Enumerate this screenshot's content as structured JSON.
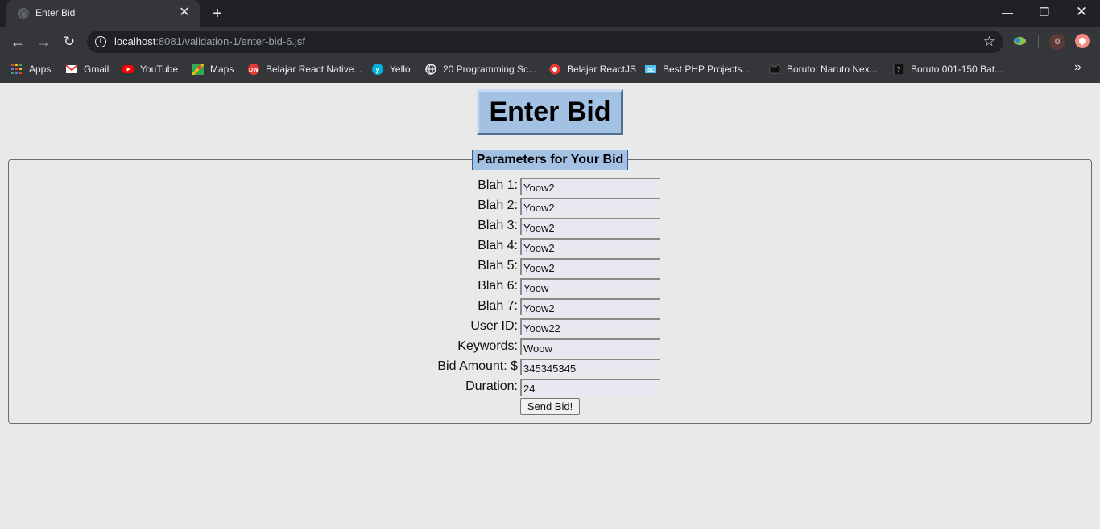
{
  "browser": {
    "tab_title": "Enter Bid",
    "url_host": "localhost",
    "url_path": ":8081/validation-1/enter-bid-6.jsf",
    "extension_badge_count": "0",
    "bookmarks": [
      {
        "label": "Apps",
        "icon": "apps-grid-icon",
        "color": "#ea4335"
      },
      {
        "label": "Gmail",
        "icon": "gmail-icon",
        "color": "#ea4335"
      },
      {
        "label": "YouTube",
        "icon": "youtube-icon",
        "color": "#ff0000"
      },
      {
        "label": "Maps",
        "icon": "maps-icon",
        "color": "#34a853"
      },
      {
        "label": "Belajar React Native...",
        "icon": "dw-icon",
        "color": "#e53935"
      },
      {
        "label": "Yello",
        "icon": "yello-icon",
        "color": "#00b0d8"
      },
      {
        "label": "20 Programming Sc...",
        "icon": "globe-icon",
        "color": "#e8eaed"
      },
      {
        "label": "Belajar ReactJS",
        "icon": "reactjs-icon",
        "color": "#e53935"
      },
      {
        "label": "Best PHP Projects...",
        "icon": "isc-icon",
        "color": "#4fc3f7"
      },
      {
        "label": "Boruto: Naruto Nex...",
        "icon": "cat-icon",
        "color": "#111111"
      },
      {
        "label": "Boruto 001-150 Bat...",
        "icon": "boruto-icon",
        "color": "#111111"
      }
    ]
  },
  "page": {
    "title": "Enter Bid",
    "legend": "Parameters for Your Bid",
    "fields": [
      {
        "label": "Blah 1:",
        "value": "Yoow2"
      },
      {
        "label": "Blah 2:",
        "value": "Yoow2"
      },
      {
        "label": "Blah 3:",
        "value": "Yoow2"
      },
      {
        "label": "Blah 4:",
        "value": "Yoow2"
      },
      {
        "label": "Blah 5:",
        "value": "Yoow2"
      },
      {
        "label": "Blah 6:",
        "value": "Yoow"
      },
      {
        "label": "Blah 7:",
        "value": "Yoow2"
      },
      {
        "label": "User ID:",
        "value": "Yoow22"
      },
      {
        "label": "Keywords:",
        "value": "Woow"
      },
      {
        "label": "Bid Amount: $",
        "value": "345345345"
      },
      {
        "label": "Duration:",
        "value": "24"
      }
    ],
    "submit_label": "Send Bid!"
  },
  "colors": {
    "title_bg": "#a3c1e3",
    "page_bg": "#e9e9e9",
    "chrome_dark": "#202124",
    "chrome_mid": "#35363a"
  }
}
